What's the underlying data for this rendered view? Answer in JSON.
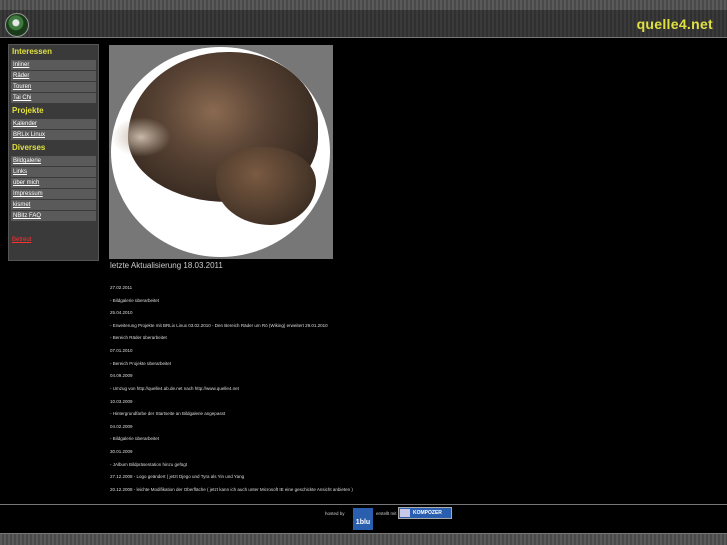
{
  "header": {
    "site_title": "quelle4.net"
  },
  "sidebar": {
    "sections": [
      {
        "title": "Interessen",
        "items": [
          "Inliner",
          "Räder",
          "Touren",
          "Tai Chi"
        ]
      },
      {
        "title": "Projekte",
        "items": [
          "Kalender",
          "BRLix Linux"
        ]
      },
      {
        "title": "Diverses",
        "items": [
          "Bildgalerie",
          "Links",
          "über mich",
          "Impressum",
          "kismet",
          "NBitz FAQ"
        ]
      }
    ],
    "red_link": "Betreut"
  },
  "main": {
    "update_heading": "letzte Aktualisierung 18.03.2011",
    "log": [
      "27.02.2011",
      "- Bildgalerie überarbeitet",
      "25.04.2010",
      "- Erweiterung Projekte mit BRLix Linux  03.02.2010 - Den Bereich Räder um  Rö (Wiking) erweitert 29.01.2010",
      "- Bereich Räder überarbeitet",
      "07.01.2010",
      "- Bereich Projekte überarbeitet",
      "04.09.2009",
      "- Umzug von http://quelle4.ab.de.net nach http://www.quelle4.net",
      "10.03.2009",
      "- Hintergrundfarbe der Startseite an Bildgalerie angepasst",
      "04.02.2009",
      "- Bildgalerie überarbeitet",
      "30.01.2009",
      "- JAlbum Bildpräsentation hinzu gefügt",
      "27.12.2008 - Logo geändert ( jetzt Djego und Tyra als Yin und Yang",
      "20.12.2008 - leichte Modifikation der Oberfläche ( jetzt kann ich auch unter Microsoft IE eine geschickte Ansicht anbieten  )"
    ]
  },
  "footer": {
    "hosted_by": "hosted by",
    "host_logo": "1blu",
    "created_with": "erstellt mit",
    "editor_badge": "KOMPOZER"
  },
  "colors": {
    "accent_yellow": "#e0e040",
    "link_red": "#ff3030"
  }
}
